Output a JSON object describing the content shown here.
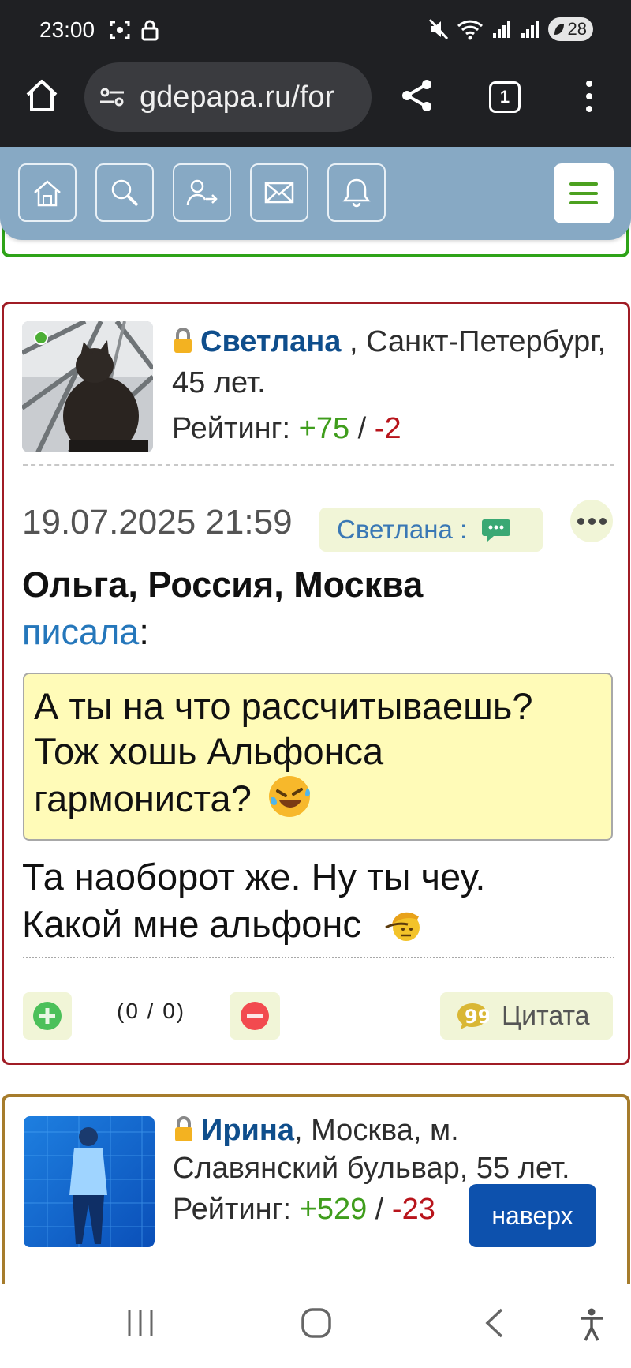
{
  "status_bar": {
    "time": "23:00",
    "battery": "28"
  },
  "browser": {
    "url": "gdepapa.ru/for",
    "tab_count": "1"
  },
  "post": {
    "author": "Светлана",
    "location_prefix": " , Санкт-Петербург, 45 лет.",
    "rating_label": "Рейтинг: ",
    "rating_plus": "+75",
    "rating_sep": " / ",
    "rating_minus": "-2",
    "date": "19.07.2025 21:59",
    "reply_label": "Светлана :",
    "quote_author": "Ольга, Россия, Москва",
    "quote_wrote": "писала",
    "quote_colon": ":",
    "quote_text": "А ты на что рассчитываешь? Тож хошь Альфонса гармониста?",
    "message_line1": "Та наоборот же. Ну ты чеу.",
    "message_line2": "Какой мне альфонс",
    "votes": "(0 / 0)",
    "quote_button": "Цитата"
  },
  "next_post": {
    "author": "Ирина",
    "location": ", Москва, м. Славянский бульвар, 55 лет.",
    "rating_label": "Рейтинг: ",
    "rating_plus": "+529",
    "rating_sep": " / ",
    "rating_minus": "-23"
  },
  "to_top_button": "наверх",
  "colors": {
    "accent_green": "#3f9d1c",
    "accent_red": "#b8141b",
    "nav_panel": "#87a9c4",
    "link_blue": "#0f4e8c"
  }
}
